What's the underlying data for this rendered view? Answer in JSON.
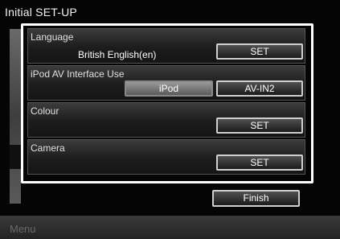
{
  "window": {
    "title": "Initial SET-UP"
  },
  "sections": {
    "language": {
      "label": "Language",
      "value": "British English(en)",
      "button": "SET"
    },
    "ipod": {
      "label": "iPod AV Interface Use",
      "option_ipod": "iPod",
      "option_av": "AV-IN2",
      "selected": "iPod"
    },
    "colour": {
      "label": "Colour",
      "button": "SET"
    },
    "camera": {
      "label": "Camera",
      "button": "SET"
    }
  },
  "footer": {
    "finish_label": "Finish",
    "menu_label": "Menu"
  },
  "colors": {
    "background": "#050505",
    "panel_border": "#ffffff",
    "active_button": "#808080"
  }
}
